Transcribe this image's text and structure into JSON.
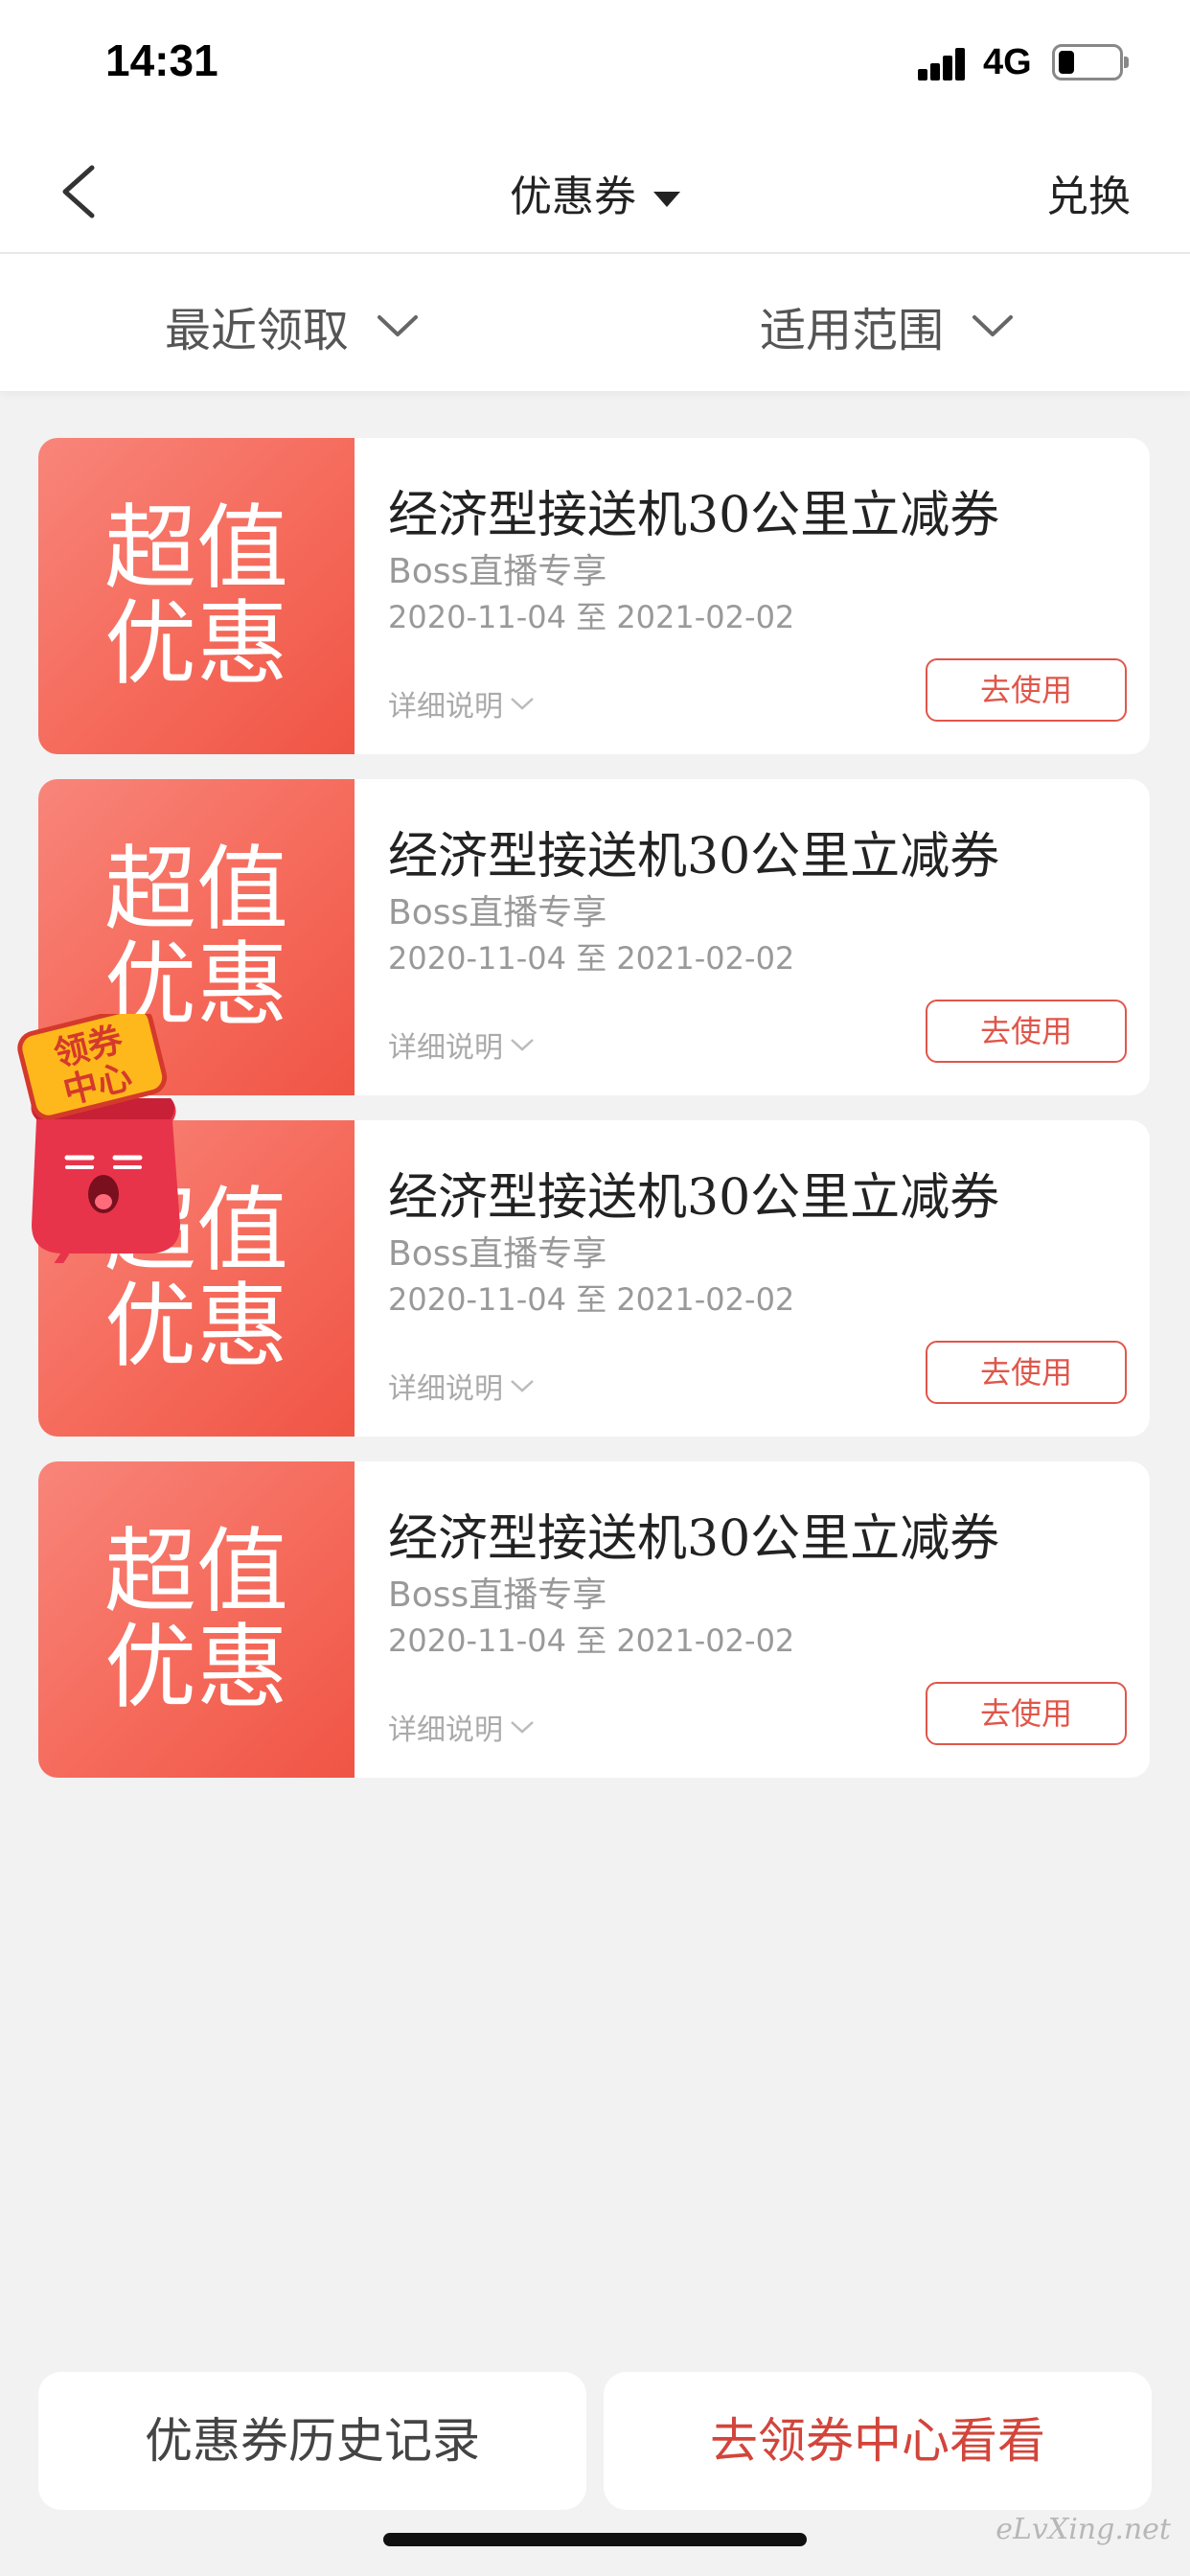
{
  "status_bar": {
    "time": "14:31",
    "network": "4G"
  },
  "nav": {
    "title": "优惠券",
    "exchange": "兑换"
  },
  "filters": {
    "recent": "最近领取",
    "scope": "适用范围"
  },
  "coupons": [
    {
      "badge_line1": "超值",
      "badge_line2": "优惠",
      "title": "经济型接送机30公里立减券",
      "subtitle": "Boss直播专享",
      "date_range": "2020-11-04 至 2021-02-02",
      "detail": "详细说明",
      "use_label": "去使用"
    },
    {
      "badge_line1": "超值",
      "badge_line2": "优惠",
      "title": "经济型接送机30公里立减券",
      "subtitle": "Boss直播专享",
      "date_range": "2020-11-04 至 2021-02-02",
      "detail": "详细说明",
      "use_label": "去使用"
    },
    {
      "badge_line1": "超值",
      "badge_line2": "优惠",
      "title": "经济型接送机30公里立减券",
      "subtitle": "Boss直播专享",
      "date_range": "2020-11-04 至 2021-02-02",
      "detail": "详细说明",
      "use_label": "去使用"
    },
    {
      "badge_line1": "超值",
      "badge_line2": "优惠",
      "title": "经济型接送机30公里立减券",
      "subtitle": "Boss直播专享",
      "date_range": "2020-11-04 至 2021-02-02",
      "detail": "详细说明",
      "use_label": "去使用"
    }
  ],
  "mascot": {
    "line1": "领券",
    "line2": "中心"
  },
  "bottom": {
    "history": "优惠券历史记录",
    "center": "去领券中心看看"
  },
  "watermark": "eLvXing.net",
  "colors": {
    "accent": "#f56a5b",
    "button_red": "#e0564a",
    "link_red": "#d2453b"
  }
}
